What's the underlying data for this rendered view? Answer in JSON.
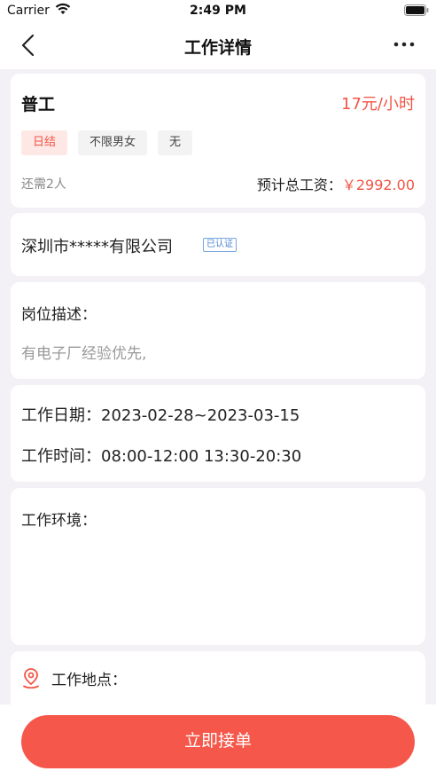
{
  "status_bar": {
    "carrier": "Carrier",
    "time": "2:49 PM"
  },
  "nav": {
    "title": "工作详情"
  },
  "job": {
    "title": "普工",
    "wage": "17元/小时",
    "tags": [
      "日结",
      "不限男女",
      "无"
    ],
    "need": "还需2人",
    "total_label": "预计总工资：",
    "total_amount": "￥2992.00"
  },
  "company": {
    "name": "深圳市*****有限公司",
    "verified": "已认证"
  },
  "description": {
    "label": "岗位描述：",
    "text": "有电子厂经验优先,"
  },
  "schedule": {
    "date": "工作日期：2023-02-28~2023-03-15",
    "time": "工作时间：08:00-12:00 13:30-20:30"
  },
  "environment": {
    "label": "工作环境："
  },
  "location": {
    "label": "工作地点："
  },
  "action": {
    "accept_label": "立即接单"
  },
  "colors": {
    "accent": "#f5574a",
    "price": "#f25546",
    "background": "#f3f1f6",
    "verified": "#4a84d2"
  }
}
